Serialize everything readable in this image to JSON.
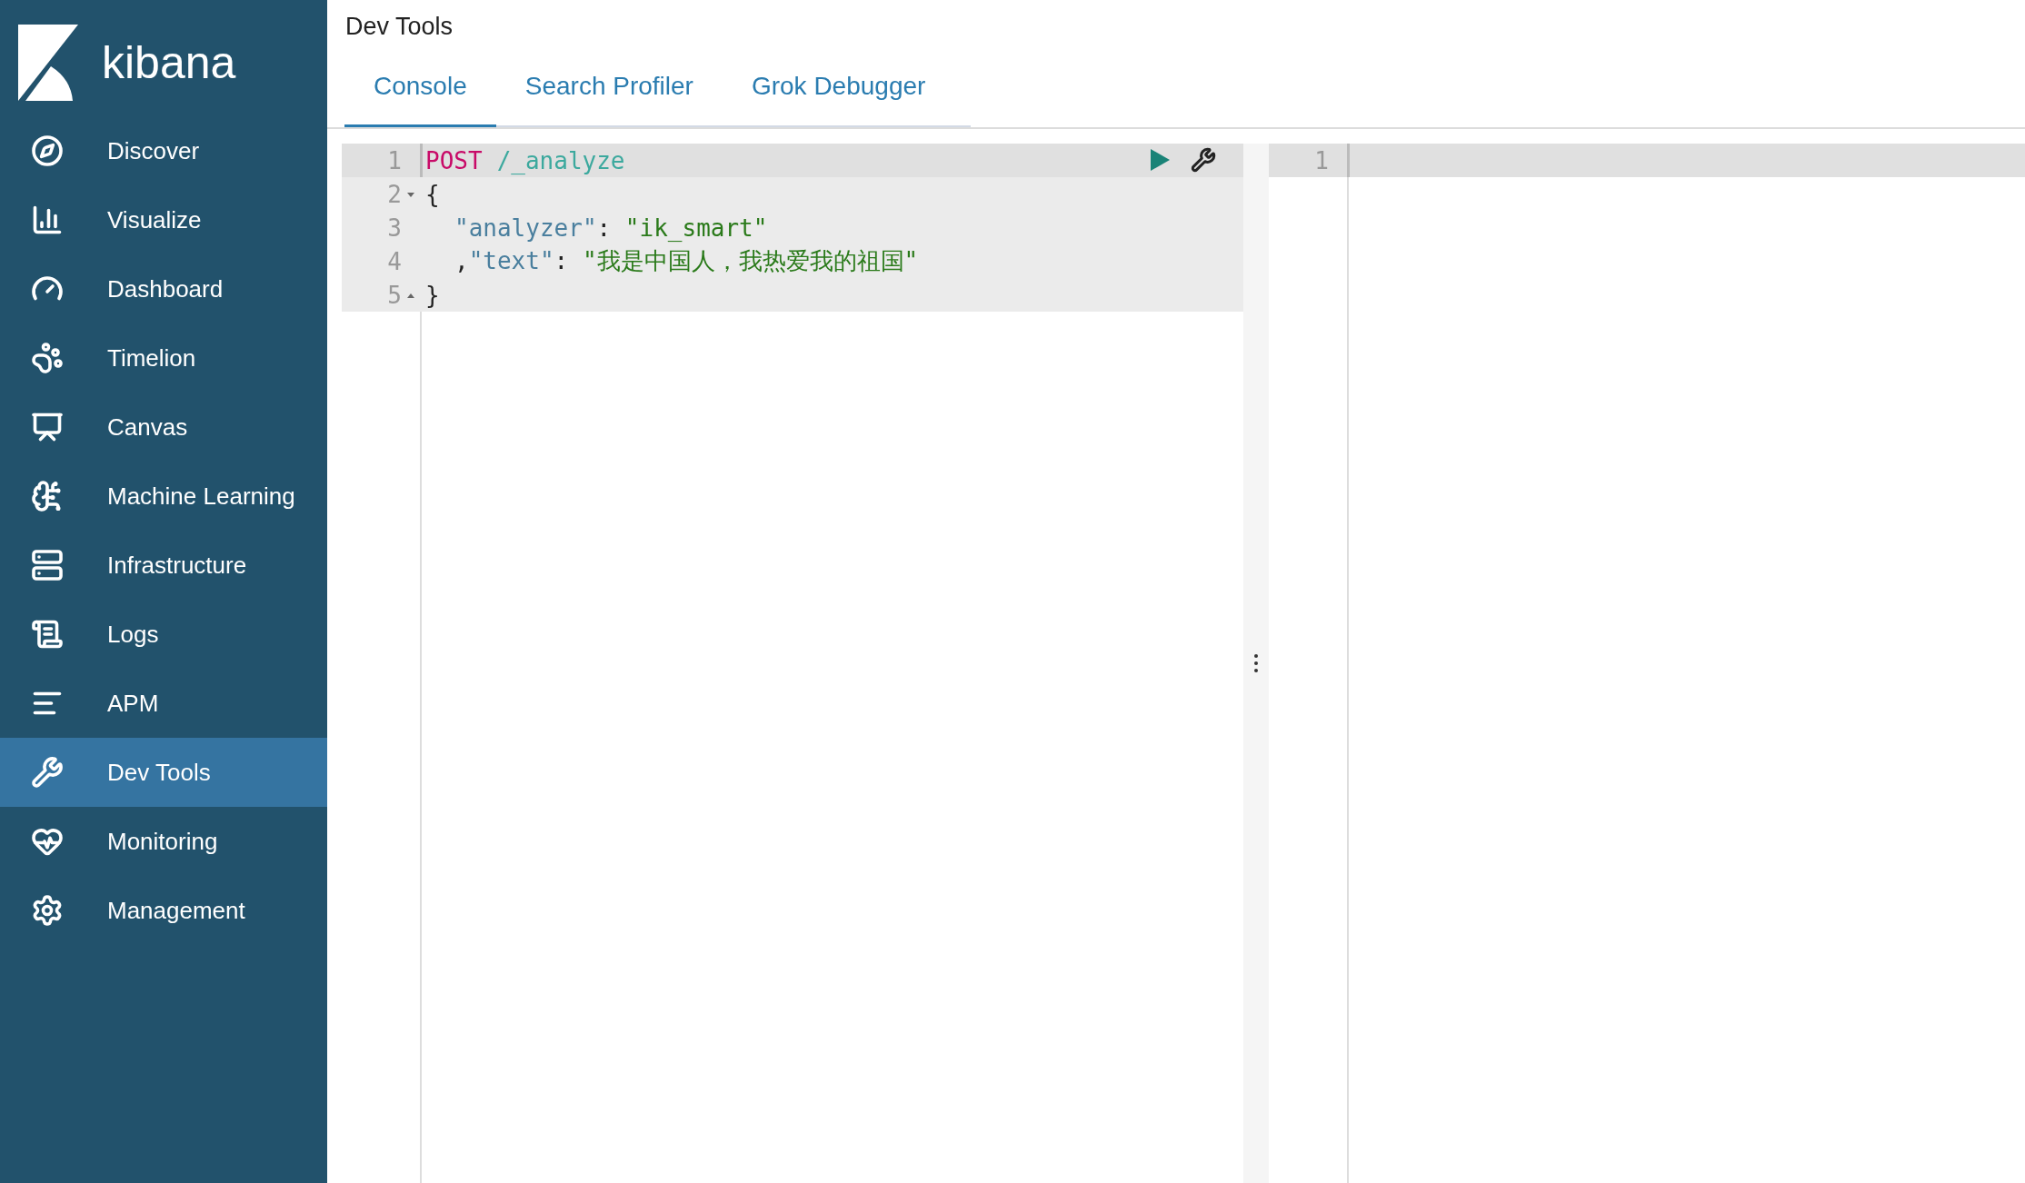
{
  "logo": {
    "text": "kibana"
  },
  "nav": [
    {
      "label": "Discover",
      "selected": false
    },
    {
      "label": "Visualize",
      "selected": false
    },
    {
      "label": "Dashboard",
      "selected": false
    },
    {
      "label": "Timelion",
      "selected": false
    },
    {
      "label": "Canvas",
      "selected": false
    },
    {
      "label": "Machine Learning",
      "selected": false
    },
    {
      "label": "Infrastructure",
      "selected": false
    },
    {
      "label": "Logs",
      "selected": false
    },
    {
      "label": "APM",
      "selected": false
    },
    {
      "label": "Dev Tools",
      "selected": true
    },
    {
      "label": "Monitoring",
      "selected": false
    },
    {
      "label": "Management",
      "selected": false
    }
  ],
  "page_title": "Dev Tools",
  "tabs": [
    {
      "label": "Console",
      "selected": true
    },
    {
      "label": "Search Profiler",
      "selected": false
    },
    {
      "label": "Grok Debugger",
      "selected": false
    }
  ],
  "editor": {
    "lines": [
      {
        "number": "1",
        "active": true,
        "indented": false,
        "fold_start": false,
        "fold_end": false,
        "tokens": [
          {
            "kind": "method",
            "text": "POST"
          },
          {
            "kind": "url",
            "text": "/_analyze",
            "space_before": true
          }
        ]
      },
      {
        "number": "2",
        "active": false,
        "indented": false,
        "fold_start": true,
        "fold_end": false,
        "tokens": [
          {
            "kind": "plain",
            "text": "{"
          }
        ]
      },
      {
        "number": "3",
        "active": false,
        "indented": true,
        "fold_start": false,
        "fold_end": false,
        "tokens": [
          {
            "kind": "key",
            "text": "\"analyzer\""
          },
          {
            "kind": "plain",
            "text": ": "
          },
          {
            "kind": "string",
            "text": "\"ik_smart\""
          }
        ]
      },
      {
        "number": "4",
        "active": false,
        "indented": true,
        "fold_start": false,
        "fold_end": false,
        "tokens": [
          {
            "kind": "plain",
            "text": ","
          },
          {
            "kind": "key",
            "text": "\"text\""
          },
          {
            "kind": "plain",
            "text": ": "
          },
          {
            "kind": "string",
            "text": "\"我是中国人，我热爱我的祖国\""
          }
        ]
      },
      {
        "number": "5",
        "active": false,
        "indented": false,
        "fold_start": false,
        "fold_end": true,
        "tokens": [
          {
            "kind": "plain",
            "text": "}"
          }
        ]
      }
    ]
  },
  "output": {
    "lines": [
      {
        "number": "1",
        "active": true
      }
    ]
  }
}
